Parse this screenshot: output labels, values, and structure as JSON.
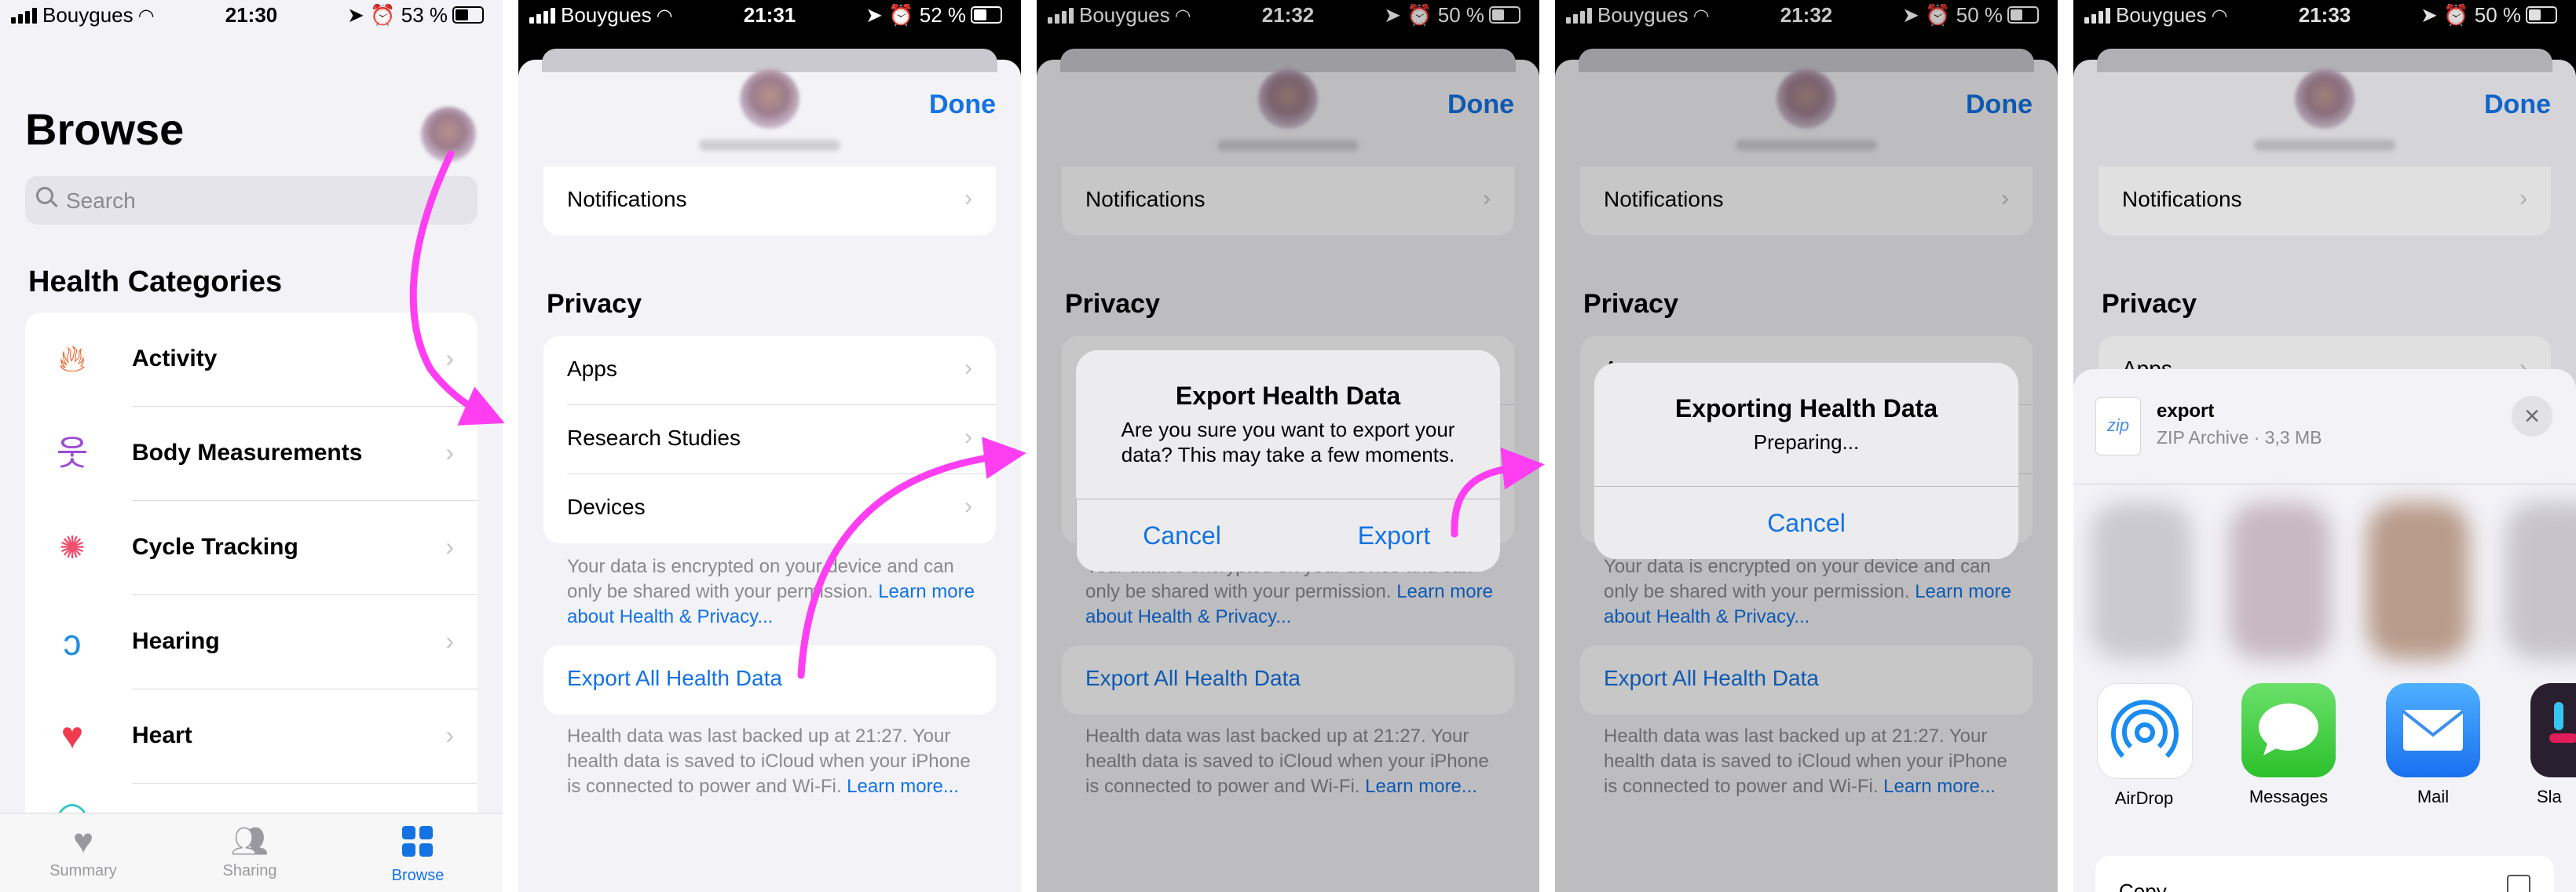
{
  "status_bars": [
    {
      "carrier": "Bouygues",
      "time": "21:30",
      "battery": "53 %"
    },
    {
      "carrier": "Bouygues",
      "time": "21:31",
      "battery": "52 %"
    },
    {
      "carrier": "Bouygues",
      "time": "21:32",
      "battery": "50 %"
    },
    {
      "carrier": "Bouygues",
      "time": "21:32",
      "battery": "50 %"
    },
    {
      "carrier": "Bouygues",
      "time": "21:33",
      "battery": "50 %"
    }
  ],
  "browse": {
    "title": "Browse",
    "search_placeholder": "Search",
    "section_title": "Health Categories",
    "categories": [
      {
        "label": "Activity",
        "icon": "flame-icon",
        "color": "#f0591a"
      },
      {
        "label": "Body Measurements",
        "icon": "figure-icon",
        "color": "#9b4dd6"
      },
      {
        "label": "Cycle Tracking",
        "icon": "cycle-icon",
        "color": "#f0506e"
      },
      {
        "label": "Hearing",
        "icon": "ear-icon",
        "color": "#1f8ee0"
      },
      {
        "label": "Heart",
        "icon": "heart-icon",
        "color": "#f03b4f"
      }
    ],
    "tabs": [
      {
        "label": "Summary",
        "icon": "heart-tab-icon"
      },
      {
        "label": "Sharing",
        "icon": "people-icon"
      },
      {
        "label": "Browse",
        "icon": "grid-icon"
      }
    ]
  },
  "profile": {
    "done_label": "Done",
    "notifications_label": "Notifications",
    "privacy_title": "Privacy",
    "privacy_items": [
      "Apps",
      "Research Studies",
      "Devices"
    ],
    "privacy_note": "Your data is encrypted on your device and can only be shared with your permission.",
    "privacy_link": "Learn more about Health & Privacy...",
    "export_label": "Export All Health Data",
    "backup_note": "Health data was last backed up at 21:27. Your health data is saved to iCloud when your iPhone is connected to power and Wi-Fi.",
    "backup_link": "Learn more..."
  },
  "confirm_alert": {
    "title": "Export Health Data",
    "message": "Are you sure you want to export your data? This may take a few moments.",
    "cancel": "Cancel",
    "export": "Export"
  },
  "progress_alert": {
    "title": "Exporting Health Data",
    "message": "Preparing...",
    "cancel": "Cancel"
  },
  "share_sheet": {
    "file_name": "export",
    "file_meta": "ZIP Archive · 3,3 MB",
    "file_type": "zip",
    "apps": [
      {
        "label": "AirDrop",
        "icon": "airdrop-icon"
      },
      {
        "label": "Messages",
        "icon": "messages-icon"
      },
      {
        "label": "Mail",
        "icon": "mail-icon"
      },
      {
        "label": "Sla",
        "icon": "slack-icon"
      }
    ],
    "copy_label": "Copy"
  },
  "colors": {
    "accent": "#1472e3",
    "annotation_arrow": "#ff3ef2"
  }
}
